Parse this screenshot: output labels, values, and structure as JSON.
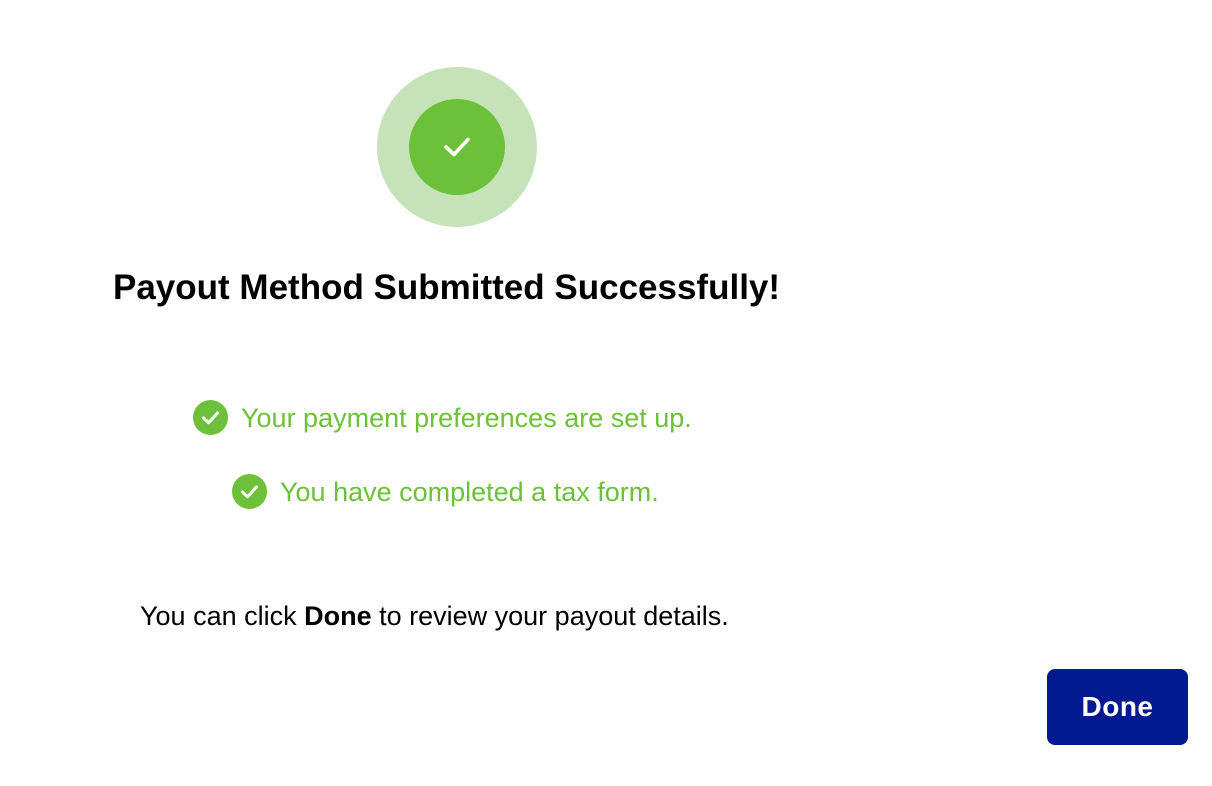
{
  "header": {
    "title": "Payout Method Submitted Successfully!",
    "success_icon": "check-icon"
  },
  "checklist": {
    "items": [
      {
        "label": "Your payment preferences are set up.",
        "icon": "check-circle-icon"
      },
      {
        "label": "You have completed a tax form.",
        "icon": "check-circle-icon"
      }
    ]
  },
  "instruction": {
    "prefix": "You can click ",
    "emphasis": "Done",
    "suffix": " to review your payout details."
  },
  "actions": {
    "done_label": "Done"
  },
  "colors": {
    "success_green": "#6cc03a",
    "success_green_light": "#c6e2b8",
    "primary_button": "#021a8f",
    "text": "#000000",
    "background": "#ffffff"
  }
}
